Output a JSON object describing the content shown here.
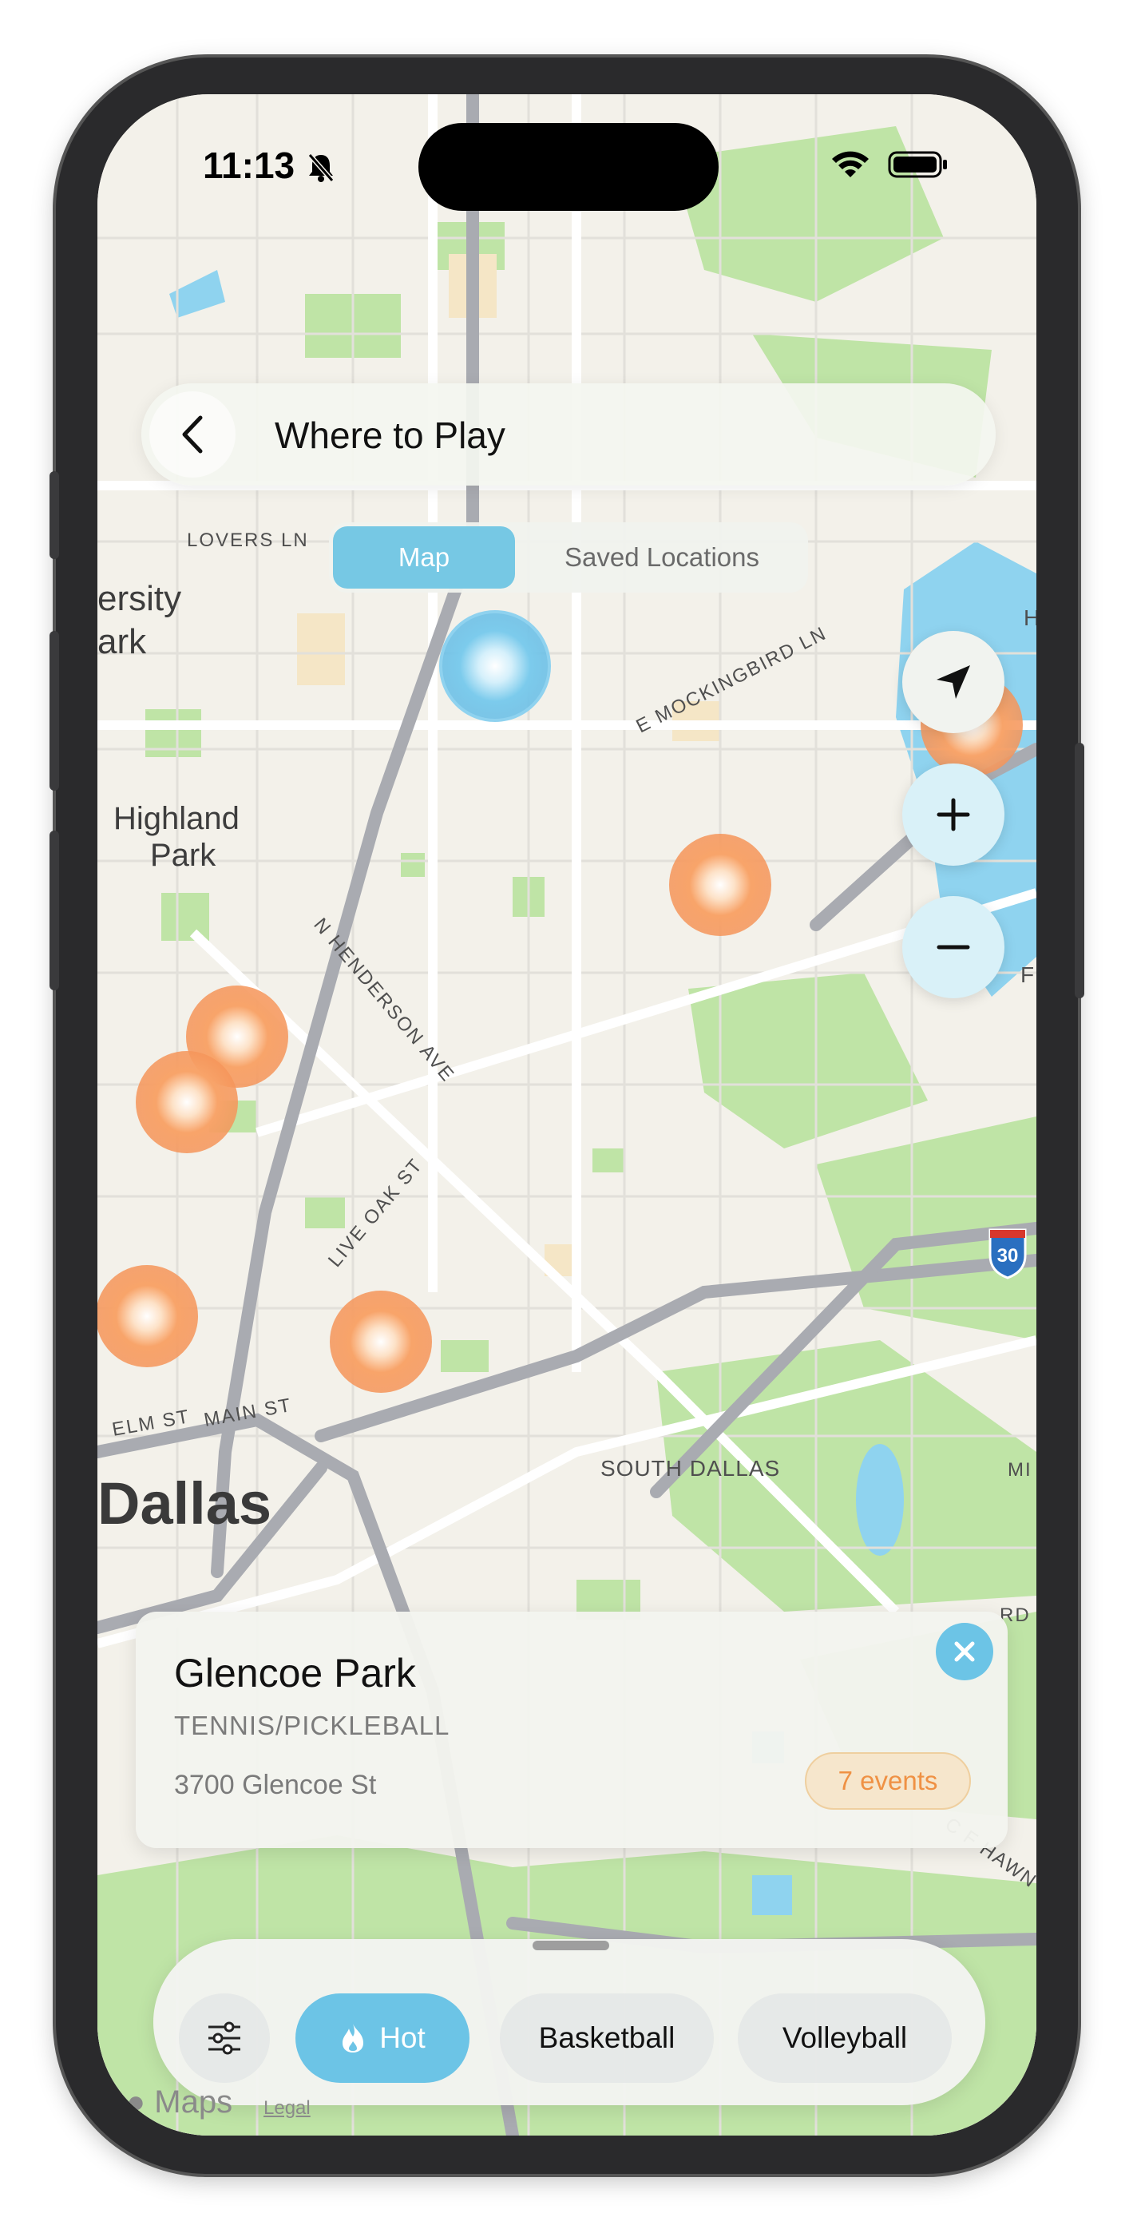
{
  "status_bar": {
    "time": "11:13"
  },
  "header": {
    "title": "Where to Play",
    "back_icon": "chevron-left-icon"
  },
  "segmented_control": {
    "items": [
      "Map",
      "Saved Locations"
    ],
    "selected": "Map"
  },
  "map": {
    "labels": {
      "lovers_ln": "LOVERS LN",
      "university_park_line1": "ersity",
      "university_park_line2": "ark",
      "highland_park_line1": "Highland",
      "highland_park_line2": "Park",
      "mockingbird": "E MOCKINGBIRD LN",
      "henderson": "N HENDERSON AVE",
      "live_oak": "LIVE OAK ST",
      "elm_st": "ELM ST",
      "main_st": "MAIN ST",
      "south_dallas": "SOUTH DALLAS",
      "dallas": "Dallas",
      "interstate": "30",
      "c_f_hawn": "C F HAWN F",
      "rd": "RD",
      "mi": "MI",
      "h": "H",
      "f": "F"
    },
    "controls": [
      "location-arrow-icon",
      "plus-icon",
      "minus-icon"
    ]
  },
  "selected_location": {
    "name": "Glencoe Park",
    "category": "TENNIS/PICKLEBALL",
    "address": "3700 Glencoe St",
    "events": "7 events"
  },
  "filter_chips": [
    {
      "label": "Hot",
      "icon": "flame-icon",
      "selected": true
    },
    {
      "label": "Basketball",
      "selected": false
    },
    {
      "label": "Volleyball",
      "selected": false
    }
  ],
  "footer": {
    "maps_brand": "Maps",
    "legal": "Legal"
  },
  "colors": {
    "accent_blue": "#6cc4e6",
    "hot_orange": "#f59a5a",
    "park_green": "#b8e2a0",
    "water_blue": "#8fd3ef"
  }
}
